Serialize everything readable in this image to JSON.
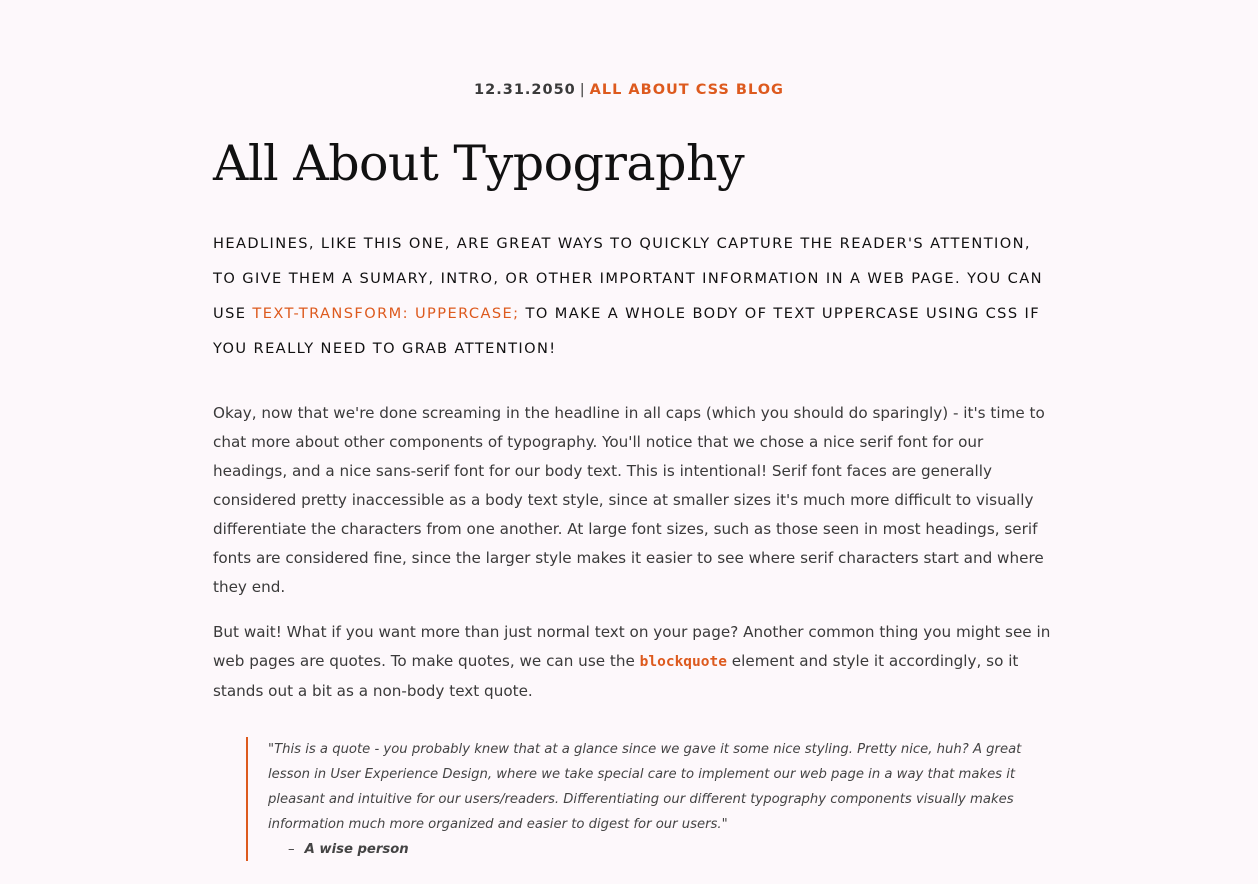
{
  "meta": {
    "date": "12.31.2050",
    "separator": "|",
    "blog_name": "All About CSS Blog",
    "colors": {
      "accent": "#dd5a1e",
      "background": "#fdf8fb",
      "heading": "#111111",
      "body": "#3a3a3a"
    }
  },
  "article": {
    "title": "All About Typography",
    "headline": {
      "part1": "Headlines, like this one, are great ways to quickly capture the reader's attention, to give them a sumary, intro, or other important information in a web page. You can use ",
      "accent": "text-transform: uppercase;",
      "part2": " to make a whole body of text uppercase using CSS if you really need to grab attention!"
    },
    "paragraph1": "Okay, now that we're done screaming in the headline in all caps (which you should do sparingly) - it's time to chat more about other components of typography. You'll notice that we chose a nice serif font for our headings, and a nice sans-serif font for our body text. This is intentional! Serif font faces are generally considered pretty inaccessible as a body text style, since at smaller sizes it's much more difficult to visually differentiate the characters from one another. At large font sizes, such as those seen in most headings, serif fonts are considered fine, since the larger style makes it easier to see where serif characters start and where they end.",
    "paragraph2": {
      "before": "But wait! What if you want more than just normal text on your page? Another common thing you might see in web pages are quotes. To make quotes, we can use the ",
      "code": "blockquote",
      "after": " element and style it accordingly, so it stands out a bit as a non-body text quote."
    },
    "quote": {
      "text": "\"This is a quote - you probably knew that at a glance since we gave it some nice styling. Pretty nice, huh? A great lesson in User Experience Design, where we take special care to implement our web page in a way that makes it pleasant and intuitive for our users/readers. Differentiating our different typography components visually makes information much more organized and easier to digest for our users.\"",
      "dash": "–",
      "author": "A wise person"
    }
  }
}
